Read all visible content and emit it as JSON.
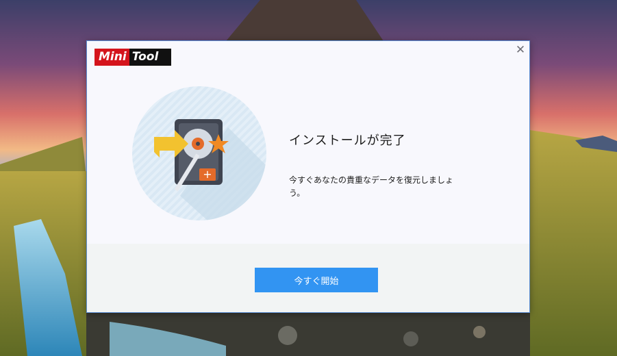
{
  "brand": {
    "mini": "Mini",
    "tool": "Tool"
  },
  "dialog": {
    "close_icon": "close-icon",
    "title": "インストールが完了",
    "description": "今すぐあなたの貴重なデータを復元しましょう。",
    "start_button": "今すぐ開始"
  },
  "colors": {
    "accent": "#3294f2",
    "brand_red": "#d4141c",
    "dialog_border": "#5b8fd6"
  }
}
